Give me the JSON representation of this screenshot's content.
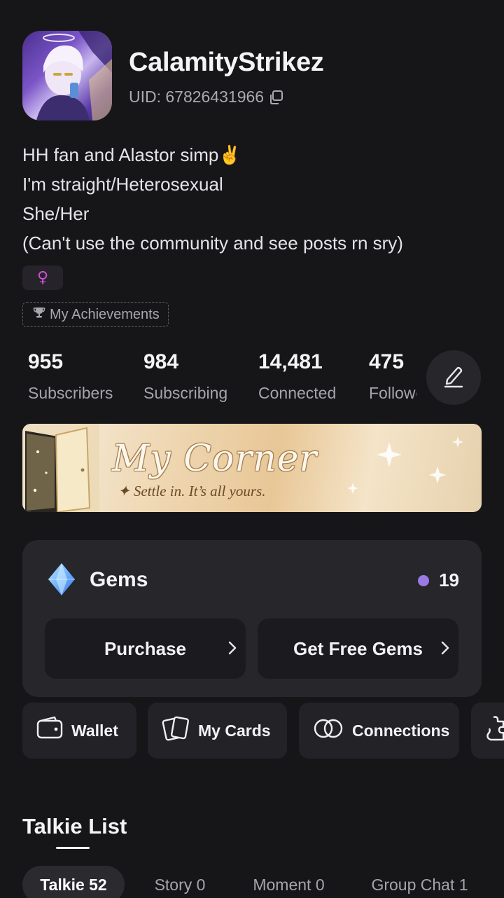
{
  "profile": {
    "username": "CalamityStrikez",
    "uid": "UID: 67826431966",
    "bio": [
      "HH fan and Alastor simp✌️",
      "I'm straight/Heterosexual",
      "She/Her",
      "(Can't use the community and see posts rn sry)"
    ],
    "gender_symbol": "♀",
    "achievements_label": "My Achievements"
  },
  "stats": [
    {
      "value": "955",
      "label": "Subscribers"
    },
    {
      "value": "984",
      "label": "Subscribing"
    },
    {
      "value": "14,481",
      "label": "Connected"
    },
    {
      "value": "475",
      "label": "Followers"
    }
  ],
  "banner": {
    "title": "My Corner",
    "subtitle": "✦ Settle in. It’s all yours."
  },
  "gems": {
    "title": "Gems",
    "count": "19",
    "purchase_label": "Purchase",
    "free_label": "Get Free Gems"
  },
  "quick_actions": {
    "wallet": "Wallet",
    "cards": "My Cards",
    "connections": "Connections"
  },
  "talkie_list": {
    "title": "Talkie List",
    "tabs": [
      "Talkie 52",
      "Story 0",
      "Moment 0",
      "Group Chat 1"
    ]
  },
  "colors": {
    "background": "#161619",
    "card": "#26262b",
    "accent_purple": "#9b7ae6",
    "gender_pink": "#d050d6"
  },
  "icons": [
    "copy-icon",
    "trophy-icon",
    "edit-icon",
    "gem-icon",
    "chevron-right-icon",
    "wallet-icon",
    "cards-icon",
    "connections-icon"
  ]
}
